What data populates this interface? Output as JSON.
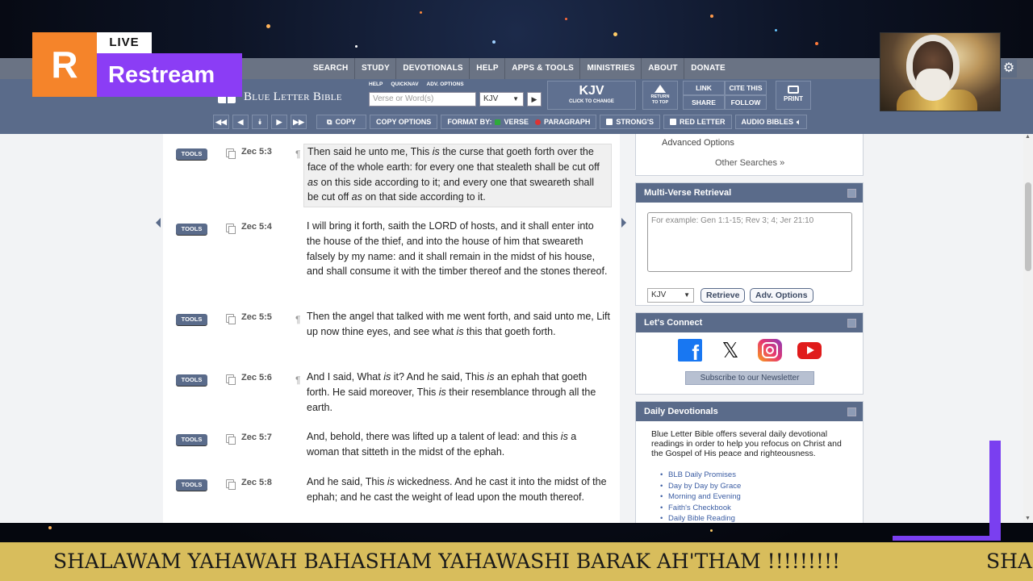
{
  "stream": {
    "brand_letter": "R",
    "live_label": "LIVE",
    "brand_name": "Restream",
    "ticker_text": "SHALAWAM YAHAWAH BAHASHAM YAHAWASHI BARAK AH'THAM !!!!!!!!!",
    "ticker_repeat": "SHA",
    "colors": {
      "brand_orange": "#f5842a",
      "brand_purple": "#8b3df5",
      "ticker_bg": "#d8bd5c"
    }
  },
  "site": {
    "name": "Blue Letter Bible",
    "topnav": [
      "SEARCH",
      "STUDY",
      "DEVOTIONALS",
      "HELP",
      "APPS & TOOLS",
      "MINISTRIES",
      "ABOUT",
      "DONATE"
    ],
    "mini_links": [
      "HELP",
      "QUICKNAV",
      "ADV. OPTIONS"
    ],
    "search_placeholder": "Verse or Word(s)",
    "version": "KJV",
    "version_box": {
      "title": "KJV",
      "subtitle": "CLICK TO CHANGE"
    },
    "return_to_top": [
      "RETURN",
      "TO TOP"
    ],
    "actions": [
      "LINK",
      "CITE THIS",
      "SHARE",
      "FOLLOW"
    ],
    "print_label": "PRINT",
    "toolbar": {
      "copy": "COPY",
      "copy_options": "COPY OPTIONS",
      "format_by": "FORMAT BY:",
      "verse": "VERSE",
      "paragraph": "PARAGRAPH",
      "strongs": "STRONG'S",
      "red_letter": "RED LETTER",
      "audio": "AUDIO BIBLES"
    },
    "colors": {
      "primary": "#5a6b8a",
      "nav": "#6a7384"
    }
  },
  "verses": [
    {
      "tools": "TOOLS",
      "ref": "Zec 5:3",
      "pilcrow": "¶",
      "text": "Then said he unto me, This is the curse that goeth forth over the face of the whole earth: for every one that stealeth shall be cut off as on this side according to it; and every one that sweareth shall be cut off as on that side according to it."
    },
    {
      "tools": "TOOLS",
      "ref": "Zec 5:4",
      "pilcrow": "",
      "text": "I will bring it forth, saith the LORD of hosts, and it shall enter into the house of the thief, and into the house of him that sweareth falsely by my name: and it shall remain in the midst of his house, and shall consume it with the timber thereof and the stones thereof."
    },
    {
      "tools": "TOOLS",
      "ref": "Zec 5:5",
      "pilcrow": "¶",
      "text": "Then the angel that talked with me went forth, and said unto me, Lift up now thine eyes, and see what is this that goeth forth."
    },
    {
      "tools": "TOOLS",
      "ref": "Zec 5:6",
      "pilcrow": "¶",
      "text": "And I said, What is it? And he said, This is an ephah that goeth forth. He said moreover, This is their resemblance through all the earth."
    },
    {
      "tools": "TOOLS",
      "ref": "Zec 5:7",
      "pilcrow": "",
      "text": "And, behold, there was lifted up a talent of lead: and this is a woman that sitteth in the midst of the ephah."
    },
    {
      "tools": "TOOLS",
      "ref": "Zec 5:8",
      "pilcrow": "",
      "text": "And he said, This is wickedness. And he cast it into the midst of the ephah; and he cast the weight of lead upon the mouth thereof."
    }
  ],
  "sidebar": {
    "advanced_options": "Advanced Options",
    "other_searches": "Other Searches »",
    "mvr": {
      "title": "Multi-Verse Retrieval",
      "placeholder": "For example: Gen 1:1-15; Rev 3; 4; Jer 21:10",
      "version": "KJV",
      "retrieve": "Retrieve",
      "adv_options": "Adv. Options"
    },
    "connect": {
      "title": "Let's Connect",
      "x_glyph": "𝕏",
      "newsletter": "Subscribe to our Newsletter"
    },
    "devotionals": {
      "title": "Daily Devotionals",
      "description": "Blue Letter Bible offers several daily devotional readings in order to help you refocus on Christ and the Gospel of His peace and righteousness.",
      "items": [
        "BLB Daily Promises",
        "Day by Day by Grace",
        "Morning and Evening",
        "Faith's Checkbook",
        "Daily Bible Reading"
      ]
    }
  }
}
